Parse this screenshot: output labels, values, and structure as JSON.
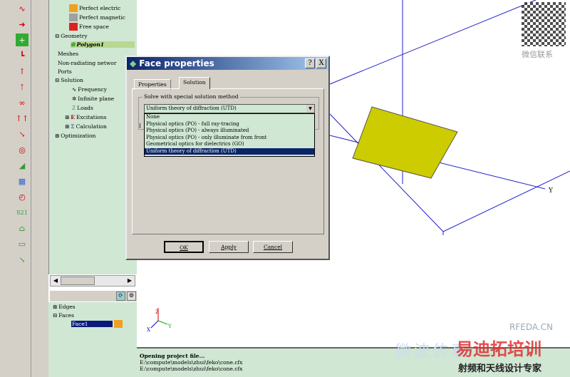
{
  "toolbar": {
    "icons": [
      "sine-icon",
      "arrow-icon",
      "add-icon",
      "rotate-icon",
      "port-icon",
      "up-arrow-icon",
      "wire-icon",
      "bead-icon",
      "excitation-icon",
      "probe-icon",
      "target-icon",
      "radar-icon",
      "signal-icon",
      "gauge-icon",
      "s21-icon",
      "antenna-icon",
      "tray-icon",
      "export-icon"
    ],
    "s21_label": "S21"
  },
  "tree": {
    "items": [
      {
        "label": "Perfect electric",
        "color": "#f0a020"
      },
      {
        "label": "Perfect magnetic",
        "color": "#a0a0a0"
      },
      {
        "label": "Free space",
        "color": "#e02020"
      },
      {
        "label": "Geometry"
      },
      {
        "label": "Polygon1"
      },
      {
        "label": "Meshes"
      },
      {
        "label": "Non-radiating networ"
      },
      {
        "label": "Ports"
      },
      {
        "label": "Solution"
      },
      {
        "label": "Frequency"
      },
      {
        "label": "Infinite plane"
      },
      {
        "label": "Loads"
      },
      {
        "label": "Excitations"
      },
      {
        "label": "Calculation"
      },
      {
        "label": "Optimization"
      }
    ]
  },
  "tree2": {
    "items": [
      {
        "label": "Edges"
      },
      {
        "label": "Faces"
      },
      {
        "label": "Face1",
        "color": "#f0a020"
      }
    ]
  },
  "dialog": {
    "title": "Face properties",
    "help": "?",
    "close": "X",
    "tabs": [
      "Properties",
      "Solution"
    ],
    "active_tab": "Solution",
    "group_label": "Solve with special solution method",
    "selected": "Uniform theory of diffraction (UTD)",
    "options": [
      "None",
      "Physical optics (PO) - full ray-tracing",
      "Physical optics (PO) - always illuminated",
      "Physical optics (PO) - only illuminate from front",
      "Geometrical optics for dielectrics (GO)",
      "Uniform theory of diffraction (UTD)"
    ],
    "hidden_label_fragment": "I",
    "ok": "OK",
    "apply": "Apply",
    "cancel": "Cancel"
  },
  "view": {
    "axis_y": "Y",
    "triad": {
      "x": "X",
      "y": "Y",
      "z": "Z"
    },
    "polygon_color": "#cccc00",
    "grid_color": "#0000cc"
  },
  "output": {
    "lines": [
      "Opening project file...",
      "E:\\compute\\models\\zhui\\feko\\cone.cfx",
      "E:\\compute\\models\\zhui\\feko\\cone.cfx"
    ]
  },
  "watermarks": {
    "qr_caption": "微信联系",
    "site": "RFEDA.CN",
    "brand": "易迪拓培训",
    "slogan": "射频和天线设计专家",
    "faint": "微波仿真"
  }
}
